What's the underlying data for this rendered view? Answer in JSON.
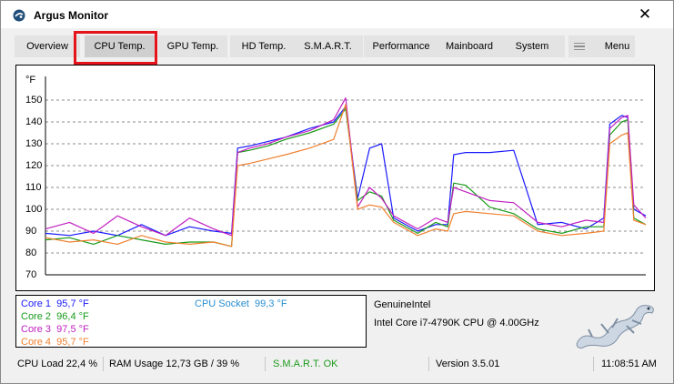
{
  "window": {
    "title": "Argus Monitor",
    "close_glyph": "✕"
  },
  "tabs": [
    {
      "label": "Overview"
    },
    {
      "label": "CPU Temp."
    },
    {
      "label": "GPU Temp."
    },
    {
      "label": "HD Temp."
    },
    {
      "label": "S.M.A.R.T."
    },
    {
      "label": "Performance"
    },
    {
      "label": "Mainboard"
    },
    {
      "label": "System"
    },
    {
      "label": "Menu"
    }
  ],
  "active_tab": "CPU Temp.",
  "chart": {
    "unit": "°F",
    "y_ticks": [
      "150",
      "140",
      "130",
      "120",
      "110",
      "100",
      "90",
      "80",
      "70"
    ]
  },
  "chart_data": {
    "type": "line",
    "ylabel": "°F",
    "ylim": [
      70,
      155
    ],
    "ytick_values": [
      70,
      80,
      90,
      100,
      110,
      120,
      130,
      140,
      150
    ],
    "grid": true,
    "x_range": [
      0,
      100
    ],
    "series": [
      {
        "name": "Core 1",
        "color": "#1a1aff",
        "x": [
          0,
          4,
          8,
          12,
          16,
          20,
          24,
          28,
          31,
          32,
          34,
          37,
          40,
          44,
          48,
          50,
          52,
          54,
          56,
          58,
          62,
          65,
          67,
          68,
          70,
          74,
          78,
          82,
          86,
          90,
          93,
          94,
          96,
          97,
          98,
          100
        ],
        "y": [
          89,
          88,
          90,
          88,
          93,
          88,
          92,
          90,
          89,
          128,
          129,
          131,
          133,
          137,
          140,
          147,
          105,
          128,
          130,
          96,
          90,
          93,
          93,
          125,
          126,
          126,
          127,
          93,
          94,
          91,
          96,
          139,
          143,
          142,
          100,
          97
        ]
      },
      {
        "name": "Core 2",
        "color": "#1a9a1a",
        "x": [
          0,
          4,
          8,
          12,
          16,
          20,
          24,
          28,
          31,
          32,
          34,
          37,
          40,
          44,
          48,
          50,
          52,
          54,
          56,
          58,
          62,
          65,
          67,
          68,
          70,
          74,
          78,
          82,
          86,
          90,
          93,
          94,
          96,
          97,
          98,
          100
        ],
        "y": [
          86,
          87,
          84,
          88,
          86,
          84,
          85,
          85,
          83,
          126,
          127,
          129,
          132,
          135,
          139,
          146,
          104,
          108,
          106,
          95,
          89,
          94,
          92,
          112,
          111,
          101,
          98,
          91,
          89,
          92,
          92,
          134,
          140,
          141,
          96,
          93
        ]
      },
      {
        "name": "Core 3",
        "color": "#c020c0",
        "x": [
          0,
          4,
          8,
          12,
          16,
          20,
          24,
          28,
          31,
          32,
          34,
          37,
          40,
          44,
          48,
          50,
          52,
          54,
          56,
          58,
          62,
          65,
          67,
          68,
          70,
          74,
          78,
          82,
          86,
          90,
          93,
          94,
          96,
          97,
          98,
          100
        ],
        "y": [
          91,
          94,
          89,
          97,
          92,
          88,
          96,
          91,
          88,
          126,
          128,
          130,
          133,
          136,
          141,
          151,
          101,
          110,
          105,
          97,
          91,
          96,
          94,
          110,
          108,
          104,
          103,
          94,
          92,
          95,
          94,
          137,
          142,
          143,
          102,
          96
        ]
      },
      {
        "name": "Core 4",
        "color": "#f08030",
        "x": [
          0,
          4,
          8,
          12,
          16,
          20,
          24,
          28,
          31,
          32,
          34,
          37,
          40,
          44,
          48,
          50,
          52,
          54,
          56,
          58,
          62,
          65,
          67,
          68,
          70,
          74,
          78,
          82,
          86,
          90,
          93,
          94,
          96,
          97,
          98,
          100
        ],
        "y": [
          87,
          85,
          86,
          84,
          88,
          85,
          84,
          85,
          83,
          120,
          121,
          123,
          125,
          128,
          132,
          148,
          100,
          102,
          101,
          94,
          88,
          91,
          90,
          98,
          99,
          98,
          97,
          90,
          88,
          89,
          90,
          130,
          134,
          135,
          95,
          93
        ]
      },
      {
        "name": "CPU Socket",
        "color": "#2a8fd0",
        "x": [
          0,
          100
        ],
        "y": [
          99.3,
          99.3
        ],
        "hidden": true
      }
    ]
  },
  "legend": {
    "cores": [
      {
        "name": "Core 1",
        "value": "95,7 °F",
        "color": "#1a1aff"
      },
      {
        "name": "Core 2",
        "value": "96,4 °F",
        "color": "#1a9a1a"
      },
      {
        "name": "Core 3",
        "value": "97,5 °F",
        "color": "#c020c0"
      },
      {
        "name": "Core 4",
        "value": "95,7 °F",
        "color": "#f08030"
      }
    ],
    "socket": {
      "name": "CPU Socket",
      "value": "99,3 °F",
      "color": "#2a8fd0"
    }
  },
  "cpu_info": {
    "vendor": "GenuineIntel",
    "model": "Intel Core i7-4790K CPU @ 4.00GHz"
  },
  "statusbar": {
    "cpu_load": "CPU Load 22,4 %",
    "ram_usage": "RAM Usage 12,73 GB / 39 %",
    "smart": "S.M.A.R.T. OK",
    "smart_color": "#1d9a1d",
    "version": "Version 3.5.01",
    "time": "11:08:51 AM"
  }
}
